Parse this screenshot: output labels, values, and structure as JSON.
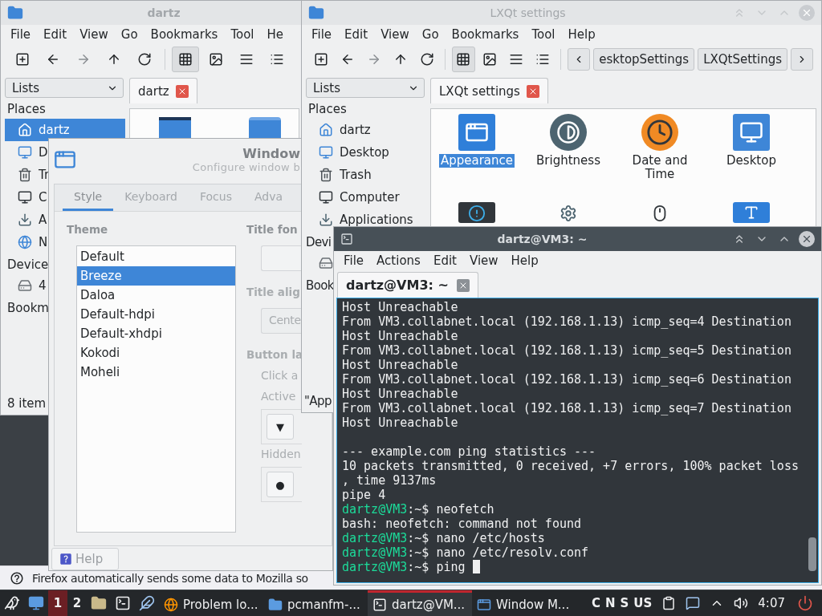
{
  "notification_bar": {
    "text": "Firefox automatically sends some data to Mozilla so"
  },
  "file_manager": {
    "title": "dartz",
    "menu": [
      "File",
      "Edit",
      "View",
      "Go",
      "Bookmarks",
      "Tool",
      "He"
    ],
    "lists_label": "Lists",
    "tab": "dartz",
    "places_heading": "Places",
    "places": [
      {
        "label": "dartz",
        "kind": "home",
        "selected": true
      },
      {
        "label": "D",
        "kind": "desktop",
        "selected": false
      },
      {
        "label": "Tr",
        "kind": "trash",
        "selected": false
      },
      {
        "label": "C",
        "kind": "computer",
        "selected": false
      },
      {
        "label": "A",
        "kind": "download",
        "selected": false
      },
      {
        "label": "N",
        "kind": "network",
        "selected": false
      }
    ],
    "devices_heading": "Device",
    "devices": [
      {
        "label": "4",
        "kind": "drive"
      }
    ],
    "bookmarks_heading": "Bookm",
    "status": "8 item"
  },
  "window_settings": {
    "title": "Window",
    "subtitle": "Configure window b",
    "tabs": [
      {
        "label": "Style",
        "selected": true
      },
      {
        "label": "Keyboard",
        "selected": false
      },
      {
        "label": "Focus",
        "selected": false
      },
      {
        "label": "Adva",
        "selected": false
      }
    ],
    "theme_heading": "Theme",
    "themes": [
      {
        "label": "Default",
        "selected": false
      },
      {
        "label": "Breeze",
        "selected": true
      },
      {
        "label": "Daloa",
        "selected": false
      },
      {
        "label": "Default-hdpi",
        "selected": false
      },
      {
        "label": "Default-xhdpi",
        "selected": false
      },
      {
        "label": "Kokodi",
        "selected": false
      },
      {
        "label": "Moheli",
        "selected": false
      }
    ],
    "title_font_label": "Title fon",
    "title_align_label": "Title alig",
    "title_align_value": "Cente",
    "button_layout_label": "Button la",
    "click_hint": "Click a",
    "active_label": "Active",
    "active_button": "▼",
    "hidden_label": "Hidden",
    "hidden_button": "●",
    "help_button": "Help"
  },
  "lxqt_settings": {
    "title": "LXQt settings",
    "menu": [
      "File",
      "Edit",
      "View",
      "Go",
      "Bookmarks",
      "Tool",
      "Help"
    ],
    "path": [
      "esktopSettings",
      "LXQtSettings"
    ],
    "lists_label": "Lists",
    "tab": "LXQt settings",
    "places_heading": "Places",
    "places": [
      {
        "label": "dartz",
        "kind": "home"
      },
      {
        "label": "Desktop",
        "kind": "desktop"
      },
      {
        "label": "Trash",
        "kind": "trash"
      },
      {
        "label": "Computer",
        "kind": "computer"
      },
      {
        "label": "Applications",
        "kind": "download"
      }
    ],
    "devices_heading": "Devi",
    "bookmarks_heading": "Book",
    "status": "\"App",
    "apps": [
      {
        "label": "Appearance",
        "kind": "window",
        "selected": true
      },
      {
        "label": "Brightness",
        "kind": "brightness",
        "selected": false
      },
      {
        "label": "Date and Time",
        "kind": "clock",
        "selected": false
      },
      {
        "label": "Desktop",
        "kind": "desktop",
        "selected": false
      }
    ]
  },
  "terminal": {
    "title": "dartz@VM3: ~",
    "menu": [
      "File",
      "Actions",
      "Edit",
      "View",
      "Help"
    ],
    "tab": "dartz@VM3: ~",
    "lines": [
      {
        "kind": "output",
        "text": "Host Unreachable"
      },
      {
        "kind": "output",
        "text": "From VM3.collabnet.local (192.168.1.13) icmp_seq=4 Destination"
      },
      {
        "kind": "output",
        "text": "Host Unreachable"
      },
      {
        "kind": "output",
        "text": "From VM3.collabnet.local (192.168.1.13) icmp_seq=5 Destination"
      },
      {
        "kind": "output",
        "text": "Host Unreachable"
      },
      {
        "kind": "output",
        "text": "From VM3.collabnet.local (192.168.1.13) icmp_seq=6 Destination"
      },
      {
        "kind": "output",
        "text": "Host Unreachable"
      },
      {
        "kind": "output",
        "text": "From VM3.collabnet.local (192.168.1.13) icmp_seq=7 Destination"
      },
      {
        "kind": "output",
        "text": "Host Unreachable"
      },
      {
        "kind": "blank"
      },
      {
        "kind": "output",
        "text": "--- example.com ping statistics ---"
      },
      {
        "kind": "output",
        "text": "10 packets transmitted, 0 received, +7 errors, 100% packet loss"
      },
      {
        "kind": "output",
        "text": ", time 9137ms"
      },
      {
        "kind": "output",
        "text": "pipe 4"
      },
      {
        "kind": "prompt",
        "user": "dartz@VM3",
        "path": ":~$",
        "text": "neofetch",
        "cursor": false
      },
      {
        "kind": "output",
        "text": "bash: neofetch: command not found"
      },
      {
        "kind": "prompt",
        "user": "dartz@VM3",
        "path": ":~$",
        "text": "nano /etc/hosts",
        "cursor": false
      },
      {
        "kind": "prompt",
        "user": "dartz@VM3",
        "path": ":~$",
        "text": "nano /etc/resolv.conf",
        "cursor": false
      },
      {
        "kind": "prompt",
        "user": "dartz@VM3",
        "path": ":~$",
        "text": "ping",
        "cursor": true
      }
    ]
  },
  "taskbar": {
    "workspaces": [
      {
        "label": "1",
        "selected": true
      },
      {
        "label": "2",
        "selected": false
      }
    ],
    "tasks": [
      {
        "label": "Problem lo...",
        "kind": "browser",
        "selected": false
      },
      {
        "label": "pcmanfm-...",
        "kind": "folder",
        "selected": false
      },
      {
        "label": "dartz@VM...",
        "kind": "terminal",
        "selected": true
      },
      {
        "label": "Window M...",
        "kind": "window",
        "selected": false
      }
    ],
    "keyboard_indicators": [
      "C",
      "N",
      "S"
    ],
    "layout": "US",
    "clock": "4:07"
  }
}
